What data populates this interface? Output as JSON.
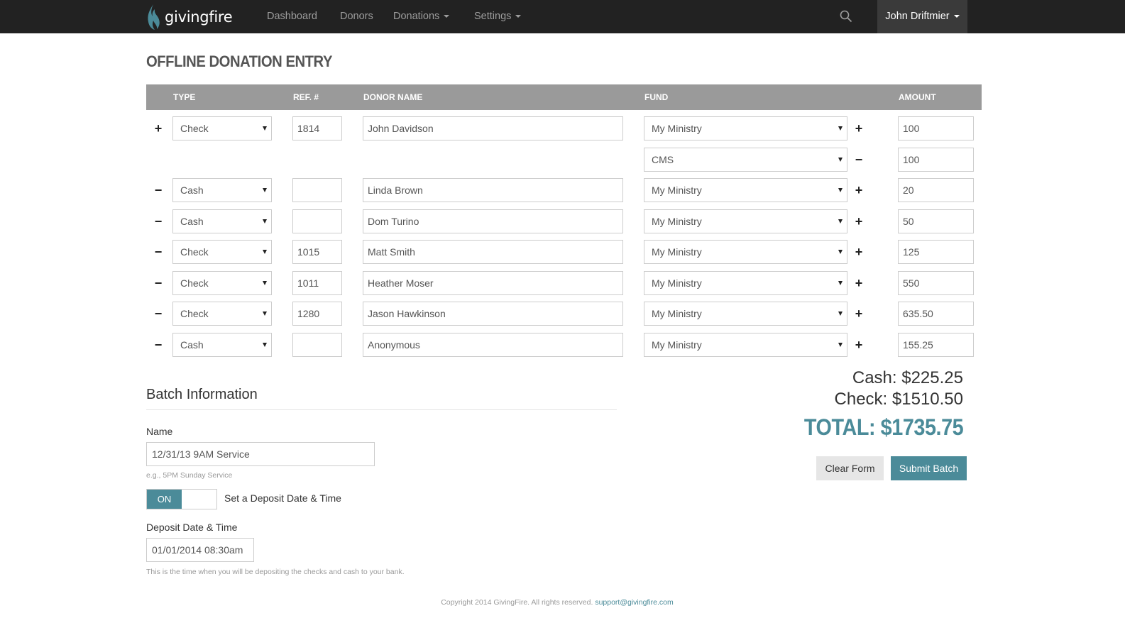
{
  "nav": {
    "brand": "givingfire",
    "items": [
      "Dashboard",
      "Donors",
      "Donations",
      "Settings"
    ],
    "user": "John Driftmier",
    "search_icon": "search-icon"
  },
  "page": {
    "title": "OFFLINE DONATION ENTRY"
  },
  "table": {
    "headers": {
      "type": "TYPE",
      "ref": "REF. #",
      "donor": "DONOR NAME",
      "fund": "FUND",
      "amount": "AMOUNT"
    },
    "rows": [
      {
        "row_icon": "+",
        "type": "Check",
        "ref": "1814",
        "donor": "John Davidson",
        "fund": "My Ministry",
        "fund_icon": "+",
        "amount": "100"
      },
      {
        "row_icon": "",
        "type": "",
        "ref": "",
        "donor": "",
        "fund": "CMS",
        "fund_icon": "−",
        "amount": "100"
      },
      {
        "row_icon": "−",
        "type": "Cash",
        "ref": "",
        "donor": "Linda Brown",
        "fund": "My Ministry",
        "fund_icon": "+",
        "amount": "20"
      },
      {
        "row_icon": "−",
        "type": "Cash",
        "ref": "",
        "donor": "Dom Turino",
        "fund": "My Ministry",
        "fund_icon": "+",
        "amount": "50"
      },
      {
        "row_icon": "−",
        "type": "Check",
        "ref": "1015",
        "donor": "Matt Smith",
        "fund": "My Ministry",
        "fund_icon": "+",
        "amount": "125"
      },
      {
        "row_icon": "−",
        "type": "Check",
        "ref": "1011",
        "donor": "Heather Moser",
        "fund": "My Ministry",
        "fund_icon": "+",
        "amount": "550"
      },
      {
        "row_icon": "−",
        "type": "Check",
        "ref": "1280",
        "donor": "Jason Hawkinson",
        "fund": "My Ministry",
        "fund_icon": "+",
        "amount": "635.50"
      },
      {
        "row_icon": "−",
        "type": "Cash",
        "ref": "",
        "donor": "Anonymous",
        "fund": "My Ministry",
        "fund_icon": "+",
        "amount": "155.25"
      }
    ]
  },
  "batch": {
    "title": "Batch Information",
    "name_label": "Name",
    "name_value": "12/31/13 9AM Service",
    "name_help": "e.g., 5PM Sunday Service",
    "toggle_state": "ON",
    "toggle_label": "Set a Deposit Date & Time",
    "deposit_label": "Deposit Date & Time",
    "deposit_value": "01/01/2014 08:30am",
    "deposit_help": "This is the time when you will be depositing the checks and cash to your bank."
  },
  "totals": {
    "cash": "Cash: $225.25",
    "check": "Check: $1510.50",
    "total": "TOTAL: $1735.75"
  },
  "actions": {
    "clear": "Clear Form",
    "submit": "Submit Batch"
  },
  "footer": {
    "copyright": "Copyright 2014 GivingFire. All rights reserved.",
    "email": "support@givingfire.com"
  },
  "colors": {
    "accent": "#4b8b99",
    "navbar": "#222222",
    "header": "#9a9a9a"
  }
}
